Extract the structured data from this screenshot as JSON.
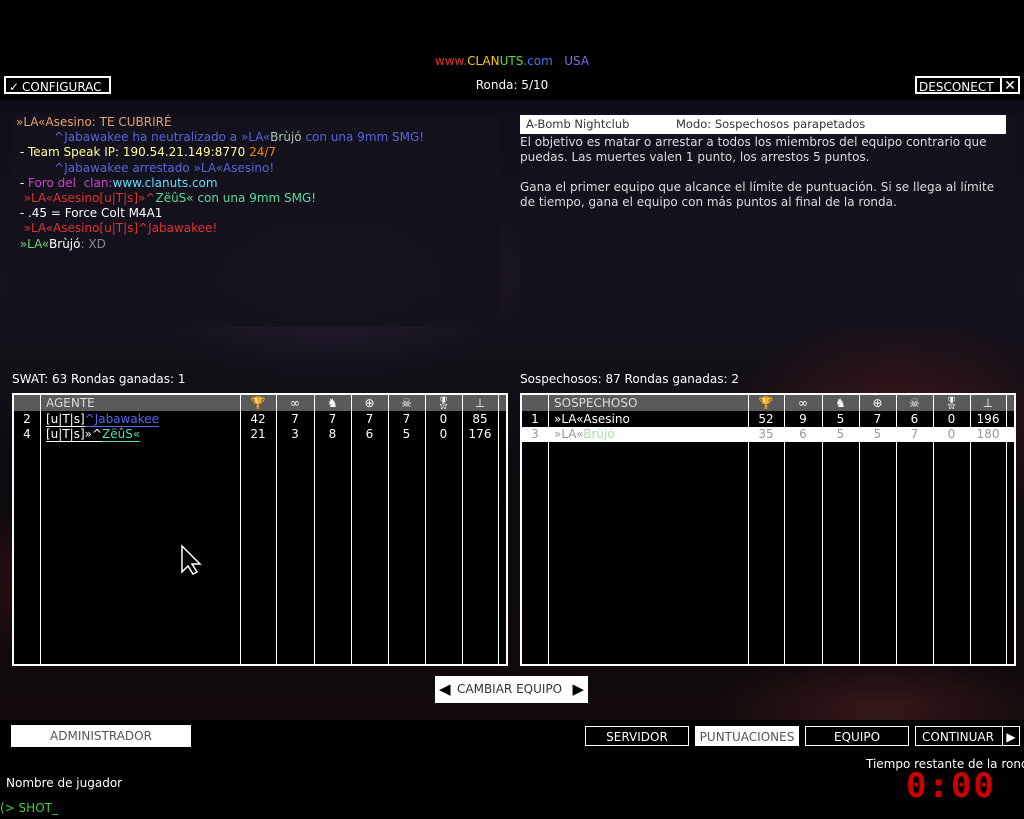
{
  "header": {
    "site_www": "www.",
    "site_clan": "CLAN",
    "site_uts": "UTS",
    "site_com": ".com",
    "site_country": "USA",
    "round": "Ronda: 5/10",
    "config_label": "CONFIGURAC",
    "disconnect_label": "DESCONECT"
  },
  "chat": [
    [
      {
        "t": "»LA«Asesino: TE CUBRIRÉ",
        "c": "#e8a070"
      }
    ],
    [
      {
        "t": "          ^Jabawakee ha neutralizado a »LA«",
        "c": "#5566dd"
      },
      {
        "t": "Brùjó",
        "c": "#aaccaa"
      },
      {
        "t": " con una 9mm SMG!",
        "c": "#5566dd"
      }
    ],
    [
      {
        "t": " - ",
        "c": "#ffffff"
      },
      {
        "t": "Team Speak IP: 190.54.21.149:8770 ",
        "c": "#ffff99"
      },
      {
        "t": "24/7",
        "c": "#ff8800"
      }
    ],
    [
      {
        "t": "          ^Jabawakee arrestado »LA«Asesino!",
        "c": "#5566dd"
      }
    ],
    [
      {
        "t": " - ",
        "c": "#ffffff"
      },
      {
        "t": "Foro del  clan:",
        "c": "#cc44cc"
      },
      {
        "t": "www.clanuts.com",
        "c": "#66ddff"
      }
    ],
    [
      {
        "t": "  »LA«Asesino[u|T|s]»^",
        "c": "#dd3333"
      },
      {
        "t": "ZëûS« con una 9mm SMG!",
        "c": "#55dd99"
      }
    ],
    [
      {
        "t": " - .45 = Force Colt M4A1",
        "c": "#ffffff"
      }
    ],
    [
      {
        "t": "  »LA«Asesino[u|T|s]^Jabawakee!",
        "c": "#dd3333"
      }
    ],
    [
      {
        "t": " »LA«",
        "c": "#66dd66"
      },
      {
        "t": "Brùjó",
        "c": "#ffffff"
      },
      {
        "t": ": XD",
        "c": "#888888"
      }
    ]
  ],
  "info": {
    "map": "A-Bomb Nightclub",
    "mode": "Modo: Sospechosos parapetados",
    "desc1": "El objetivo es matar o arrestar a todos los miembros del equipo contrario que puedas. Las muertes valen 1 punto, los arrestos 5 puntos.",
    "desc2": "Gana el primer equipo que alcance el límite de puntuación. Si se llega al límite de tiempo, gana el equipo con más puntos al final de la ronda."
  },
  "swat": {
    "title": "SWAT: 63 Rondas ganadas: 1",
    "header": "AGENTE",
    "rows": [
      {
        "num": "2",
        "tag": "[u|T|s]",
        "name": "^Jabawakee",
        "name_color": "#5566ee",
        "vals": [
          "42",
          "7",
          "7",
          "7",
          "7",
          "0",
          "85"
        ]
      },
      {
        "num": "4",
        "tag": "[u|T|s]»^",
        "name": "ZëûS«",
        "name_color": "#55ddbb",
        "vals": [
          "21",
          "3",
          "8",
          "6",
          "5",
          "0",
          "176"
        ]
      }
    ]
  },
  "suspects": {
    "title": "Sospechosos: 87 Rondas ganadas: 2",
    "header": "SOSPECHOSO",
    "rows": [
      {
        "num": "1",
        "name": "»LA«Asesino",
        "vals": [
          "52",
          "9",
          "5",
          "7",
          "6",
          "0",
          "196"
        ],
        "highlight": false
      },
      {
        "num": "3",
        "name_a": "»LA«",
        "name_b": "Brùjó",
        "vals": [
          "35",
          "6",
          "5",
          "5",
          "7",
          "0",
          "180"
        ],
        "highlight": true
      }
    ]
  },
  "icons": [
    "trophy-icon",
    "handcuffs-icon",
    "kneeling-figure-icon",
    "crosshair-icon",
    "skull-icon",
    "medal-icon",
    "network-icon"
  ],
  "buttons": {
    "change_team": "CAMBIAR EQUIPO",
    "admin": "ADMINISTRADOR",
    "server": "SERVIDOR",
    "scores": "PUNTUACIONES",
    "team": "EQUIPO",
    "continue": "CONTINUAR"
  },
  "footer": {
    "player_name_label": "Nombre de jugador",
    "prompt": "(> SHOT_",
    "time_label": "Tiempo restante de la ronda",
    "time_value": "0:00"
  }
}
